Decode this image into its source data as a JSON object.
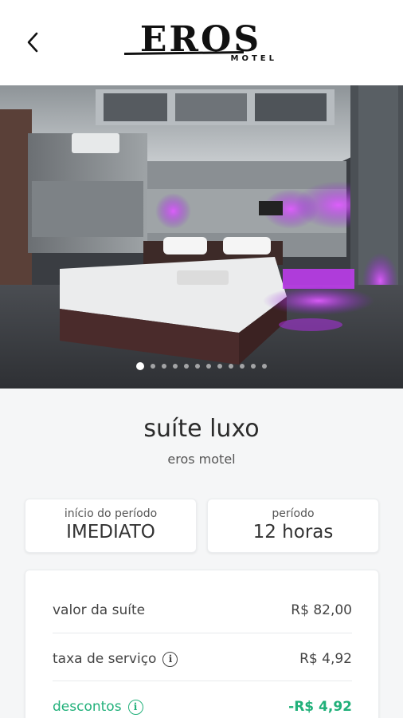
{
  "header": {
    "logo_text": "EROS",
    "logo_subtext": "MOTEL"
  },
  "gallery": {
    "image_count": 12,
    "active_index": 0
  },
  "suite": {
    "title": "suíte luxo",
    "motel_name": "eros motel"
  },
  "period": {
    "start_label": "início do período",
    "start_value": "IMEDIATO",
    "duration_label": "período",
    "duration_value": "12 horas"
  },
  "pricing": {
    "suite_value_label": "valor da suíte",
    "suite_value": "R$ 82,00",
    "service_fee_label": "taxa de serviço",
    "service_fee": "R$ 4,92",
    "discounts_label": "descontos",
    "discounts": "-R$ 4,92"
  },
  "colors": {
    "accent_green": "#21b07a",
    "neon_purple": "#b62cf0"
  }
}
